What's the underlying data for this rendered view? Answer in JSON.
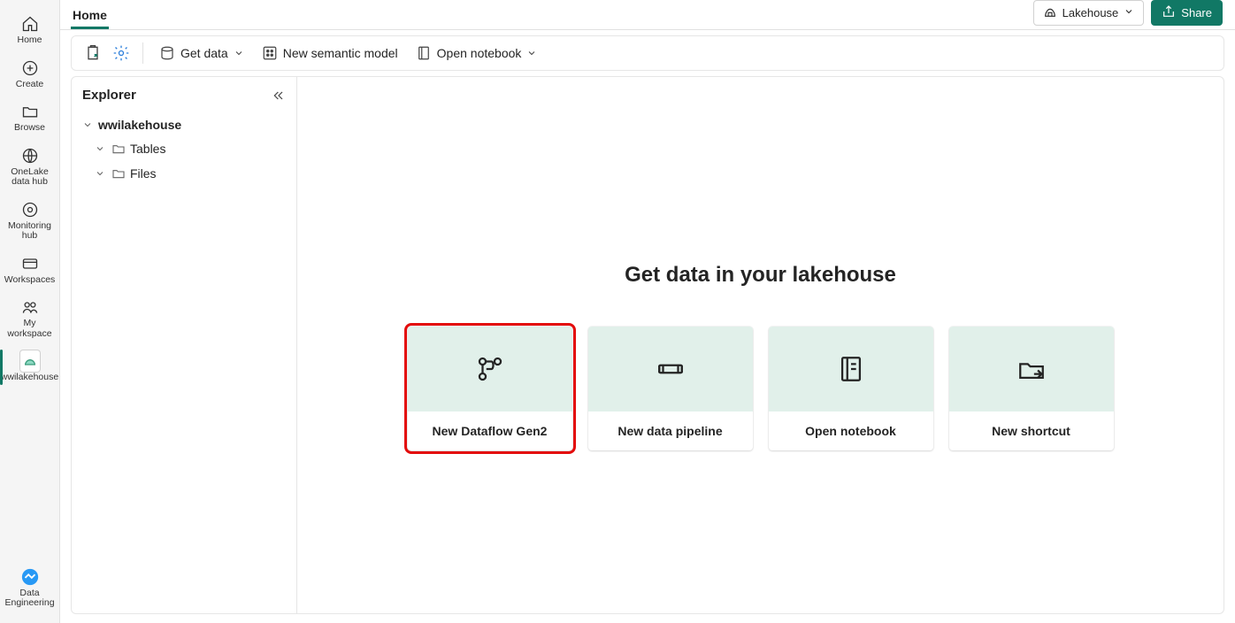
{
  "left_rail": {
    "home": "Home",
    "create": "Create",
    "browse": "Browse",
    "onelake": "OneLake data hub",
    "monitoring": "Monitoring hub",
    "workspaces": "Workspaces",
    "my_workspace": "My workspace",
    "wwilakehouse": "wwilakehouse",
    "data_engineering": "Data Engineering"
  },
  "header": {
    "tab": "Home",
    "lakehouse_label": "Lakehouse",
    "share_label": "Share"
  },
  "toolbar": {
    "get_data": "Get data",
    "new_semantic_model": "New semantic model",
    "open_notebook": "Open notebook"
  },
  "explorer": {
    "title": "Explorer",
    "root": "wwilakehouse",
    "tables": "Tables",
    "files": "Files"
  },
  "content": {
    "heading": "Get data in your lakehouse",
    "cards": {
      "dataflow": "New Dataflow Gen2",
      "pipeline": "New data pipeline",
      "notebook": "Open notebook",
      "shortcut": "New shortcut"
    }
  }
}
